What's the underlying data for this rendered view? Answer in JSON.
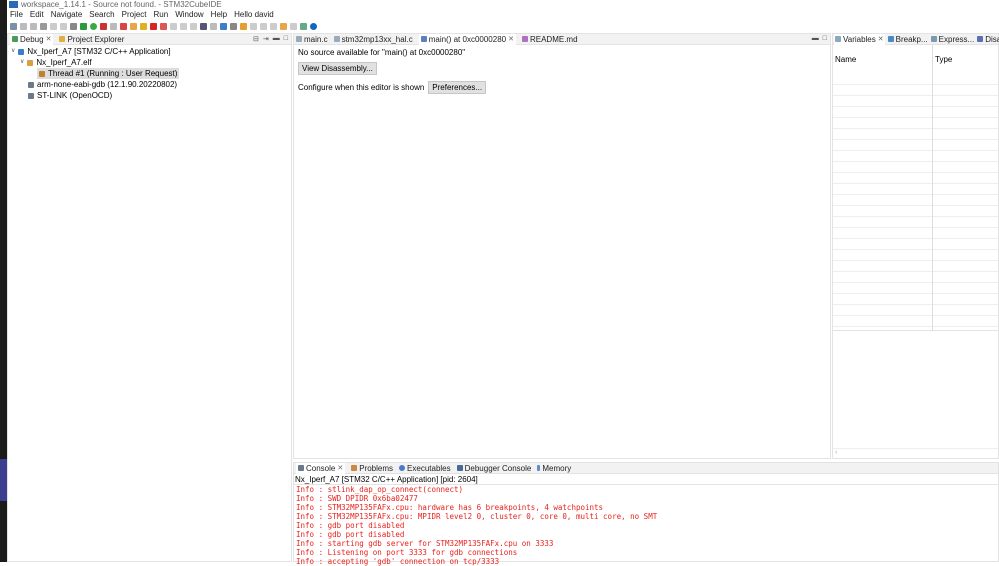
{
  "window": {
    "title": "workspace_1.14.1 - Source not found. - STM32CubeIDE"
  },
  "menu": [
    "File",
    "Edit",
    "Navigate",
    "Search",
    "Project",
    "Run",
    "Window",
    "Help",
    "Hello david"
  ],
  "left_panel": {
    "tabs": [
      {
        "label": "Debug",
        "icon": "debug-icon"
      },
      {
        "label": "Project Explorer",
        "icon": "folder-icon"
      }
    ],
    "tree": [
      {
        "label": "Nx_Iperf_A7 [STM32 C/C++ Application]",
        "level": 0
      },
      {
        "label": "Nx_Iperf_A7.elf",
        "level": 1
      },
      {
        "label": "Thread #1 (Running : User Request)",
        "level": 2,
        "selected": true
      },
      {
        "label": "arm-none-eabi-gdb (12.1.90.20220802)",
        "level": 1
      },
      {
        "label": "ST-LINK (OpenOCD)",
        "level": 1
      }
    ]
  },
  "editor": {
    "tabs": [
      "main.c",
      "stm32mp13xx_hal.c",
      "main() at 0xc0000280",
      "README.md"
    ],
    "active_tab": 2,
    "message": "No source available for \"main() at 0xc0000280\"",
    "view_disassembly": "View Disassembly...",
    "configure_label": "Configure when this editor is shown",
    "preferences": "Preferences..."
  },
  "right_panel": {
    "tabs": [
      "Variables",
      "Breakp...",
      "Express...",
      "Disa"
    ],
    "columns": [
      "Name",
      "Type"
    ]
  },
  "console": {
    "tabs": [
      "Console",
      "Problems",
      "Executables",
      "Debugger Console",
      "Memory"
    ],
    "header": "Nx_Iperf_A7 [STM32 C/C++ Application]  [pid: 2604]",
    "lines": [
      "Info : stlink_dap_op_connect(connect)",
      "Info : SWD DPIDR 0x6ba02477",
      "Info : STM32MP135FAFx.cpu: hardware has 6 breakpoints, 4 watchpoints",
      "Info : STM32MP135FAFx.cpu: MPIDR level2 0, cluster 0, core 0, multi core, no SMT",
      "Info : gdb port disabled",
      "Info : gdb port disabled",
      "Info : starting gdb server for STM32MP135FAFx.cpu on 3333",
      "Info : Listening on port 3333 for gdb connections",
      "Info : accepting 'gdb' connection on tcp/3333"
    ],
    "text_color": "#e8221d"
  }
}
